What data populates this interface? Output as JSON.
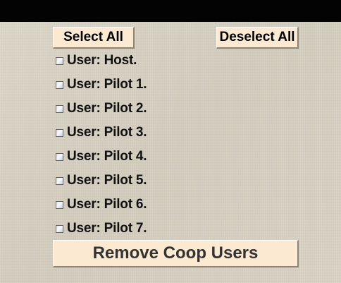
{
  "toolbar": {
    "select_all_label": "Select All",
    "deselect_all_label": "Deselect All"
  },
  "users": [
    {
      "label": "User: Host.",
      "checked": false
    },
    {
      "label": "User: Pilot 1.",
      "checked": false
    },
    {
      "label": "User: Pilot 2.",
      "checked": false
    },
    {
      "label": "User: Pilot 3.",
      "checked": false
    },
    {
      "label": "User: Pilot 4.",
      "checked": false
    },
    {
      "label": "User: Pilot 5.",
      "checked": false
    },
    {
      "label": "User: Pilot 6.",
      "checked": false
    },
    {
      "label": "User: Pilot 7.",
      "checked": false
    }
  ],
  "actions": {
    "remove_label": "Remove Coop Users"
  },
  "colors": {
    "button_face": "#fce9d1",
    "background": "#d9d3c4",
    "top_bar": "#030303"
  }
}
